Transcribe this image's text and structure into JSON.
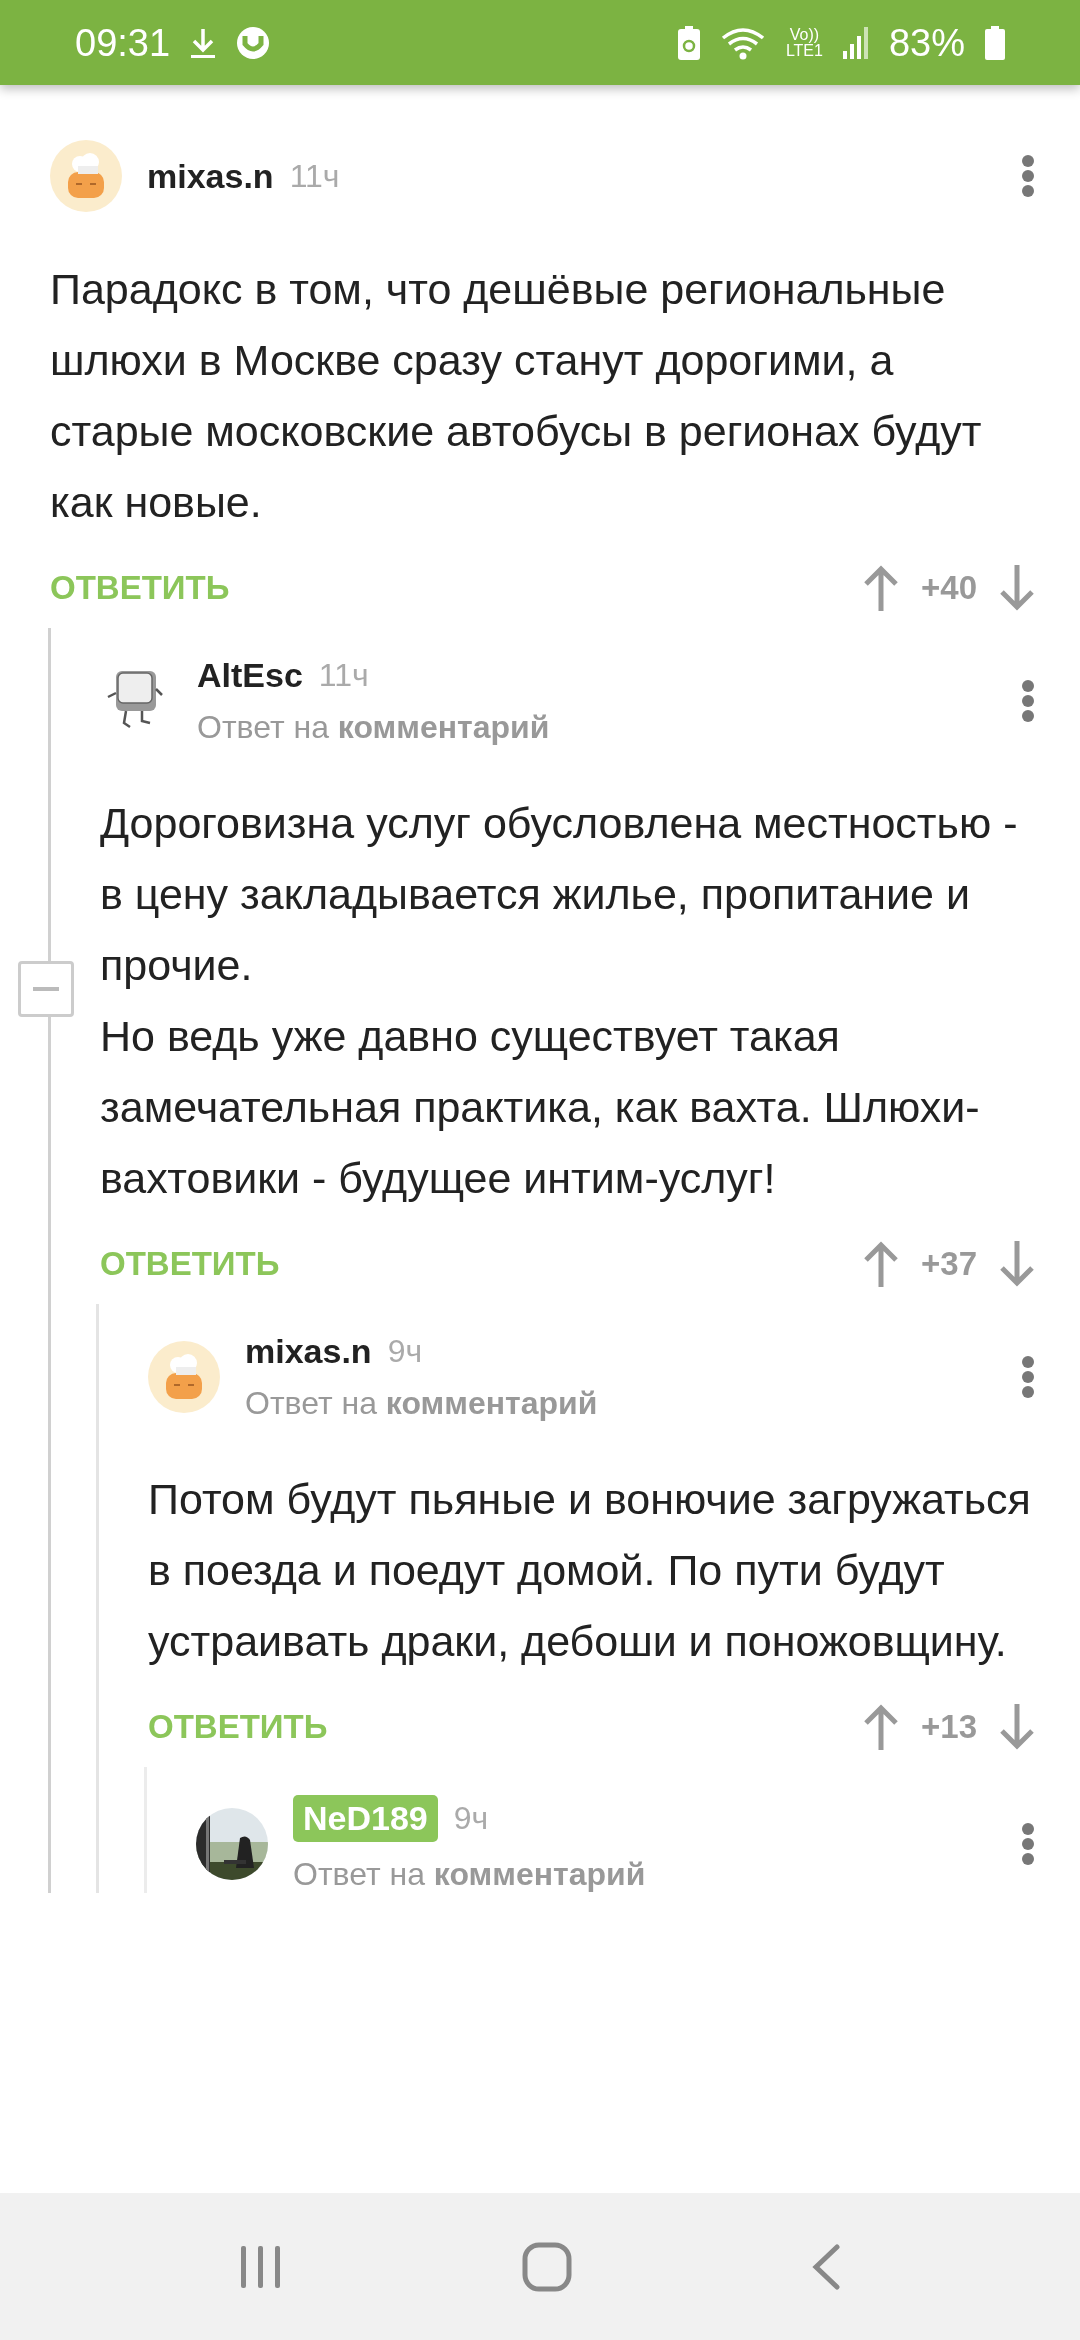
{
  "status_bar": {
    "time": "09:31",
    "volte": "Vo))",
    "network": "LTE1",
    "battery": "83%"
  },
  "comments": [
    {
      "author": "mixas.n",
      "author_highlighted": false,
      "avatar": {
        "kind": "chef"
      },
      "time": "11ч",
      "paragraphs": [
        "Парадокс в том, что дешёвые региональные шлюхи в Москве сразу станут дорогими, а старые московские автобусы в регионах будут как новые."
      ],
      "reply_label": "ОТВЕТИТЬ",
      "score": "+40",
      "collapse_control": true,
      "children": [
        {
          "author": "AltEsc",
          "author_highlighted": false,
          "avatar": {
            "kind": "key"
          },
          "time": "11ч",
          "reply_to": "Ответ на **комментарий**",
          "paragraphs": [
            "Дороговизна услуг обусловлена местностью - в цену закладывается жилье, пропитание и прочие.",
            "Но ведь уже давно существует такая замечательная практика, как вахта. Шлюхи-вахтовики - будущее интим-услуг!"
          ],
          "reply_label": "ОТВЕТИТЬ",
          "score": "+37",
          "children": [
            {
              "author": "mixas.n",
              "author_highlighted": false,
              "avatar": {
                "kind": "chef"
              },
              "time": "9ч",
              "reply_to": "Ответ на **комментарий**",
              "paragraphs": [
                "Потом будут пьяные и вонючие загружаться в поезда и поедут домой. По пути будут устраивать драки, дебоши и поножовщину."
              ],
              "reply_label": "ОТВЕТИТЬ",
              "score": "+13",
              "children": [
                {
                  "author": "NeD189",
                  "author_highlighted": true,
                  "time": "9ч",
                  "reply_to": "Ответ на **комментарий**"
                }
              ]
            }
          ]
        }
      ]
    }
  ]
}
